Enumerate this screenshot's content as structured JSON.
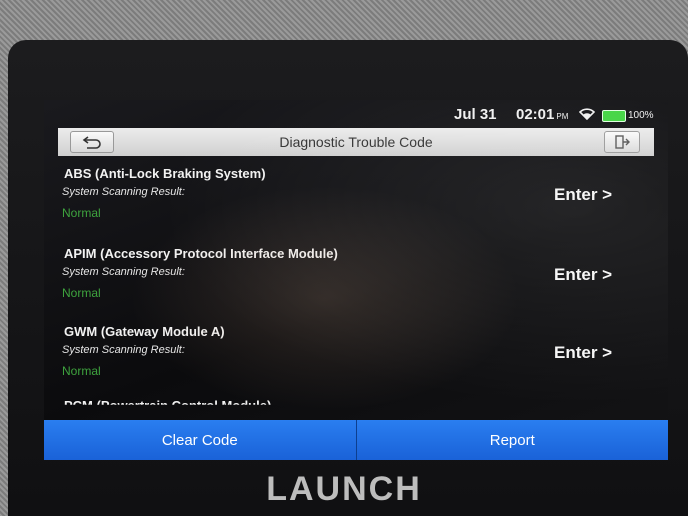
{
  "status_bar": {
    "date": "Jul 31",
    "time": "02:01",
    "ampm": "PM",
    "battery_level": "100%"
  },
  "title_bar": {
    "title": "Diagnostic Trouble Code",
    "back_icon": "back-arrow-icon",
    "exit_icon": "exit-door-icon"
  },
  "systems": [
    {
      "name": "ABS (Anti-Lock Braking System)",
      "result_label": "System Scanning Result:",
      "result": "Normal",
      "enter_label": "Enter >"
    },
    {
      "name": "APIM (Accessory Protocol Interface Module)",
      "result_label": "System Scanning Result:",
      "result": "Normal",
      "enter_label": "Enter >"
    },
    {
      "name": "GWM (Gateway Module A)",
      "result_label": "System Scanning Result:",
      "result": "Normal",
      "enter_label": "Enter >"
    },
    {
      "name": "PCM (Powertrain Control Module)"
    }
  ],
  "actions": {
    "clear_code": "Clear Code",
    "report": "Report"
  },
  "brand": "LAUNCH",
  "colors": {
    "action_blue": "#1a62d8",
    "normal_green": "#3ea33e",
    "battery_green": "#3fd43f"
  }
}
